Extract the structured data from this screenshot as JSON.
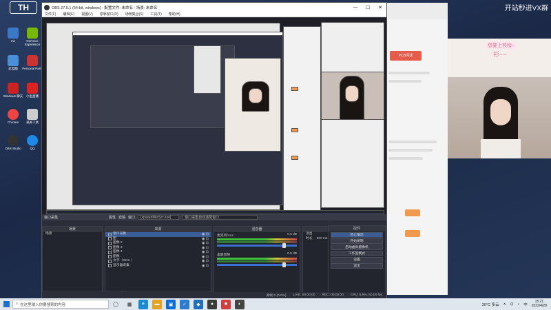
{
  "desktop": {
    "badge": "TH",
    "watermark": "开站秒进VX群",
    "icons": [
      {
        "label": "ms",
        "color": "#3b78c8"
      },
      {
        "label": "GeForce Experience",
        "color": "#76b900"
      },
      {
        "label": "此电脑",
        "color": "#4a90d9"
      },
      {
        "label": "Personal Party",
        "color": "#c33"
      },
      {
        "label": "Windows 聊天",
        "color": "#c22"
      },
      {
        "label": "小鱼直播",
        "color": "#d22"
      },
      {
        "label": "Chrome",
        "color": "#e44"
      },
      {
        "label": "录屏工具",
        "color": "#ccc"
      },
      {
        "label": "OBS Studio",
        "color": "#333"
      },
      {
        "label": "QQ",
        "color": "#1e8ae6"
      }
    ]
  },
  "right_window": {
    "button_label": "PCB闪话"
  },
  "cam": {
    "banner_top": "想要上热榜~",
    "banner_bottom": "衫~~"
  },
  "obs": {
    "title": "OBS 27.0.1 (64-bit, windows) - 配置文件: 未命名 - 场景: 未命名",
    "window_controls": [
      "—",
      "☐",
      "✕"
    ],
    "menu": [
      "文件(F)",
      "编辑(E)",
      "视图(V)",
      "停靠窗口(D)",
      "场景集合(S)",
      "工具(T)",
      "帮助(H)"
    ],
    "source_toolbar": {
      "window_capture": "窗口采集",
      "props": "属性",
      "filters": "滤镜",
      "window_label": "窗口",
      "window_value": "[xposedWinScr.exe]",
      "capture_method": "窗口采集自动适配窗口"
    },
    "panels": {
      "scenes": {
        "title": "场景",
        "items": [
          "场景"
        ]
      },
      "sources": {
        "title": "来源",
        "items": [
          "窗口采集",
          "图",
          "图像 2",
          "图像 3",
          "图像 4",
          "图像",
          "文字（GDI+）",
          "显示器采集"
        ]
      },
      "mixer": {
        "title": "混音器",
        "channels": [
          {
            "name": "麦克风/Aux",
            "db": "0.0 dB"
          },
          {
            "name": "桌面音频",
            "db": "0.0 dB"
          }
        ]
      },
      "transitions": {
        "title": "转场特效",
        "type": "淡出",
        "duration_label": "时长",
        "duration": "300 ms"
      },
      "controls": {
        "title": "控件",
        "buttons": [
          "停止推流",
          "开始录制",
          "启动虚拟摄像机",
          "工作室模式",
          "设置",
          "退出"
        ]
      }
    },
    "status": {
      "live": "LIVE: 00:00:00",
      "rec": "REC: 00:00:00",
      "cpu": "CPU: 5.9%, 60.00 fps",
      "dropped": "丢帧 0 (0.0%)"
    }
  },
  "taskbar": {
    "search_placeholder": "在这里输入你要搜索的内容",
    "weather": "20°C 多云",
    "ime": "中",
    "time": "15:21",
    "date": "2022/4/28"
  }
}
